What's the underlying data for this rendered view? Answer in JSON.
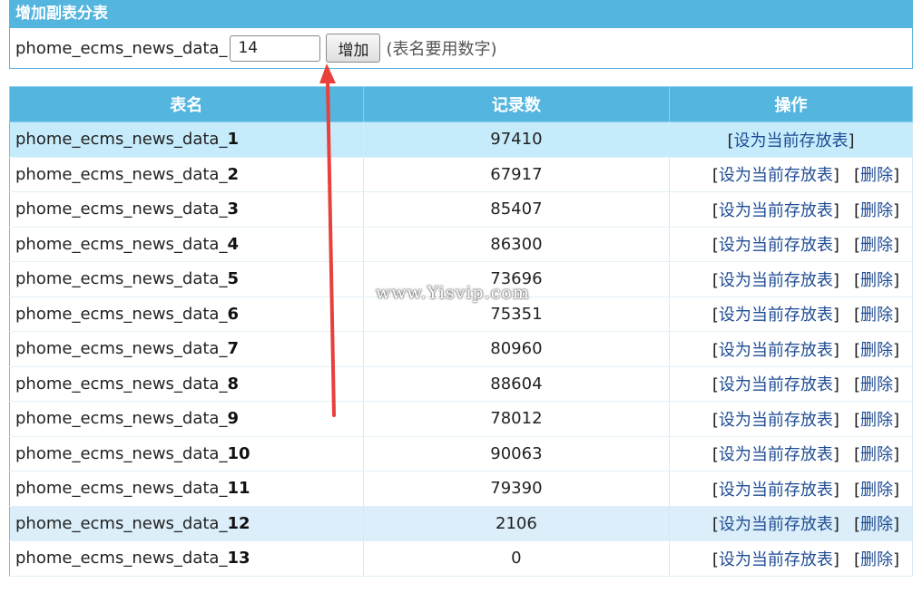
{
  "add_panel": {
    "title": "增加副表分表",
    "prefix": "phome_ecms_news_data_",
    "input_value": "14",
    "add_button": "增加",
    "hint": "(表名要用数字)"
  },
  "table": {
    "headers": [
      "表名",
      "记录数",
      "操作"
    ],
    "rows": [
      {
        "prefix": "phome_ecms_news_data_",
        "suffix": "1",
        "count": "97410",
        "current": true
      },
      {
        "prefix": "phome_ecms_news_data_",
        "suffix": "2",
        "count": "67917"
      },
      {
        "prefix": "phome_ecms_news_data_",
        "suffix": "3",
        "count": "85407"
      },
      {
        "prefix": "phome_ecms_news_data_",
        "suffix": "4",
        "count": "86300"
      },
      {
        "prefix": "phome_ecms_news_data_",
        "suffix": "5",
        "count": "73696"
      },
      {
        "prefix": "phome_ecms_news_data_",
        "suffix": "6",
        "count": "75351"
      },
      {
        "prefix": "phome_ecms_news_data_",
        "suffix": "7",
        "count": "80960"
      },
      {
        "prefix": "phome_ecms_news_data_",
        "suffix": "8",
        "count": "88604"
      },
      {
        "prefix": "phome_ecms_news_data_",
        "suffix": "9",
        "count": "78012"
      },
      {
        "prefix": "phome_ecms_news_data_",
        "suffix": "10",
        "count": "90063"
      },
      {
        "prefix": "phome_ecms_news_data_",
        "suffix": "11",
        "count": "79390"
      },
      {
        "prefix": "phome_ecms_news_data_",
        "suffix": "12",
        "count": "2106",
        "hover": true
      },
      {
        "prefix": "phome_ecms_news_data_",
        "suffix": "13",
        "count": "0"
      }
    ],
    "set_current_label": "设为当前存放表",
    "delete_label": "删除",
    "bracket_open": "[",
    "bracket_close": "]"
  },
  "watermark": "www.Yisvip.com",
  "colors": {
    "header_bg": "#54b5df",
    "current_row_bg": "#c6ecfb",
    "hover_row_bg": "#dbeef9",
    "arrow": "#e8403c",
    "link_text": "#1e4c93"
  },
  "icons": {
    "annotation": "red-arrow-icon"
  }
}
